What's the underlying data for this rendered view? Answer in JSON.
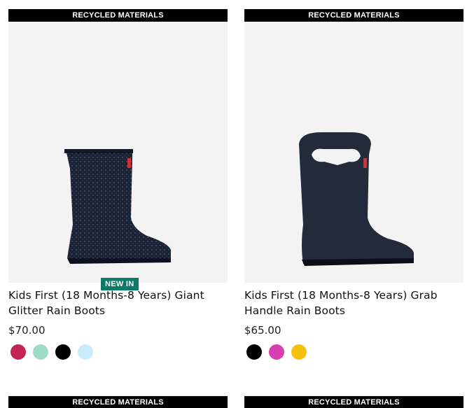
{
  "products": [
    {
      "banner": "RECYCLED MATERIALS",
      "badge": "NEW IN",
      "title": "Kids First (18 Months-8 Years) Giant Glitter Rain Boots",
      "price": "$70.00",
      "image_icon": "glitter-rain-boot",
      "swatches": [
        "#c42653",
        "#9fdcc8",
        "#000000",
        "#c8ecfb"
      ]
    },
    {
      "banner": "RECYCLED MATERIALS",
      "badge": "",
      "title": "Kids First (18 Months-8 Years) Grab Handle Rain Boots",
      "price": "$65.00",
      "image_icon": "grab-handle-rain-boot",
      "swatches": [
        "#000000",
        "#d93fb1",
        "#f3c10e"
      ]
    }
  ],
  "next_row": [
    {
      "banner": "RECYCLED MATERIALS"
    },
    {
      "banner": "RECYCLED MATERIALS"
    }
  ]
}
